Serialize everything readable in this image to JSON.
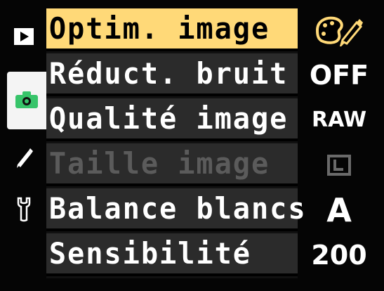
{
  "menu": {
    "items": [
      {
        "label": "Optim. image",
        "state": "selected"
      },
      {
        "label": "Réduct. bruit",
        "state": "normal"
      },
      {
        "label": "Qualité image",
        "state": "normal"
      },
      {
        "label": "Taille image",
        "state": "disabled"
      },
      {
        "label": "Balance blancs",
        "state": "normal"
      },
      {
        "label": "Sensibilité",
        "state": "normal"
      }
    ]
  },
  "values": {
    "optim_icon": "palette-pencil-icon",
    "reduct": "OFF",
    "qualite": "RAW",
    "taille_icon": "size-L-icon",
    "balance": "A",
    "sensibilite": "200"
  },
  "sidebar": {
    "icons": [
      "playback-icon",
      "camera-icon",
      "pencil-icon",
      "wrench-icon"
    ],
    "active": "camera-icon"
  },
  "colors": {
    "selected_bg": "#ffd978",
    "accent_green": "#39d26b",
    "text_white": "#ffffff",
    "disabled_gray": "#5b5b5b"
  }
}
